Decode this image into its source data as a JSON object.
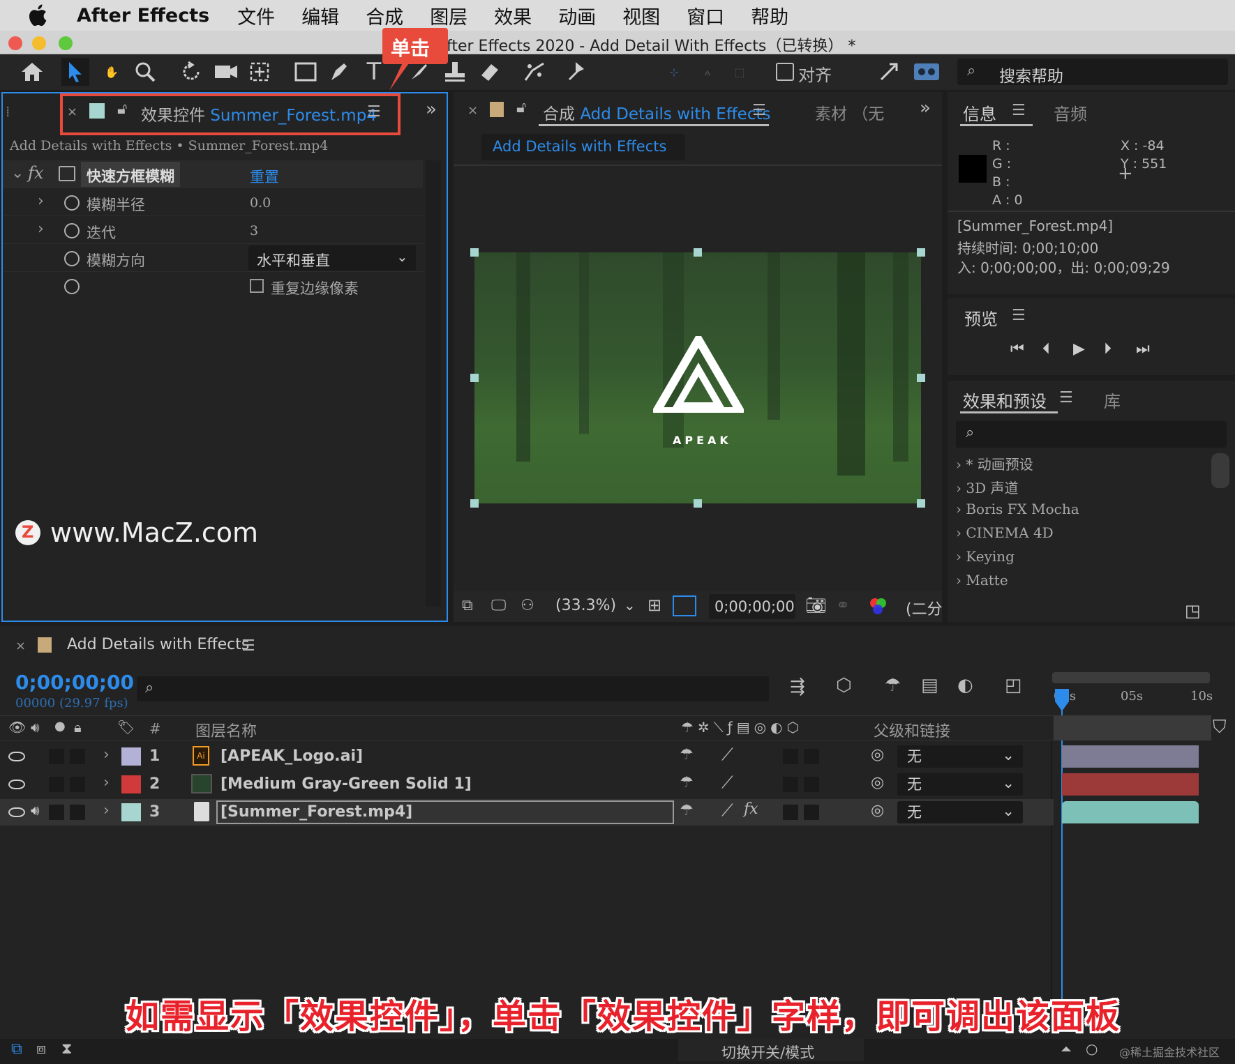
{
  "menubar": {
    "app": "After Effects",
    "items": [
      "文件",
      "编辑",
      "合成",
      "图层",
      "效果",
      "动画",
      "视图",
      "窗口",
      "帮助"
    ]
  },
  "window": {
    "title": "fter Effects 2020 - Add Detail With Effects（已转换） *"
  },
  "callout": {
    "label": "单击"
  },
  "toolbar": {
    "align_label": "对齐",
    "search_placeholder": "搜索帮助"
  },
  "effects_panel": {
    "tab_prefix": "效果控件",
    "tab_file": "Summer_Forest.mp4",
    "breadcrumb": "Add Details with Effects • Summer_Forest.mp4",
    "effect_name": "快速方框模糊",
    "reset": "重置",
    "props": [
      {
        "label": "模糊半径",
        "value": "0.0"
      },
      {
        "label": "迭代",
        "value": "3"
      },
      {
        "label": "模糊方向",
        "value": "水平和垂直"
      },
      {
        "label": "",
        "value": "重复边缘像素"
      }
    ],
    "watermark": "www.MacZ.com"
  },
  "comp_panel": {
    "tab_prefix": "合成",
    "tab_name": "Add Details with Effects",
    "other_tab": "素材 （无",
    "comp_button": "Add Details with Effects",
    "logo_text": "APEAK",
    "zoom": "(33.3%)",
    "timecode": "0;00;00;00",
    "resolution": "(二分"
  },
  "info_panel": {
    "tab_info": "信息",
    "tab_audio": "音频",
    "r": "R :",
    "g": "G :",
    "b": "B :",
    "a": "A :  0",
    "x": "X : -84",
    "y": "Y :  551",
    "file": "[Summer_Forest.mp4]",
    "duration": "持续时间: 0;00;10;00",
    "inout": "入: 0;00;00;00，出: 0;00;09;29"
  },
  "preview_panel": {
    "title": "预览"
  },
  "presets_panel": {
    "tab": "效果和预设",
    "tab2": "库",
    "items": [
      "* 动画预设",
      "3D 声道",
      "Boris FX Mocha",
      "CINEMA 4D",
      "Keying",
      "Matte"
    ]
  },
  "timeline": {
    "comp_name": "Add Details with Effects",
    "timecode": "0;00;00;00",
    "fps": "00000 (29.97 fps)",
    "col_num": "#",
    "col_name": "图层名称",
    "col_parent": "父级和链接",
    "ruler": [
      "00s",
      "05s",
      "10s"
    ],
    "layers": [
      {
        "num": "1",
        "name": "[APEAK_Logo.ai]",
        "parent": "无",
        "color": "#b3b1d6",
        "bar": "#7d7c94"
      },
      {
        "num": "2",
        "name": "[Medium Gray-Green Solid 1]",
        "parent": "无",
        "color": "#d13a3a",
        "bar": "#9c3a3a"
      },
      {
        "num": "3",
        "name": "[Summer_Forest.mp4]",
        "parent": "无",
        "color": "#a6d6cf",
        "bar": "#7cc0b8"
      }
    ],
    "footer_mode": "切换开关/模式"
  },
  "caption": "如需显示「效果控件」，单击「效果控件」字样，即可调出该面板",
  "corner_watermark": "@稀土掘金技术社区"
}
